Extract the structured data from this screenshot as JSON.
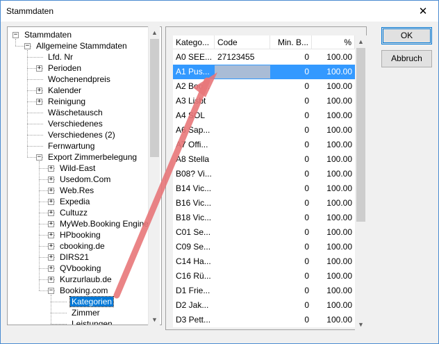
{
  "window": {
    "title": "Stammdaten"
  },
  "tree": [
    {
      "label": "Stammdaten",
      "level": 0,
      "expander": "minus"
    },
    {
      "label": "Allgemeine Stammdaten",
      "level": 1,
      "expander": "minus"
    },
    {
      "label": "Lfd. Nr",
      "level": 2,
      "expander": "none"
    },
    {
      "label": "Perioden",
      "level": 2,
      "expander": "plus"
    },
    {
      "label": "Wochenendpreis",
      "level": 2,
      "expander": "none"
    },
    {
      "label": "Kalender",
      "level": 2,
      "expander": "plus"
    },
    {
      "label": "Reinigung",
      "level": 2,
      "expander": "plus"
    },
    {
      "label": "Wäschetausch",
      "level": 2,
      "expander": "none"
    },
    {
      "label": "Verschiedenes",
      "level": 2,
      "expander": "none"
    },
    {
      "label": "Verschiedenes (2)",
      "level": 2,
      "expander": "none"
    },
    {
      "label": "Fernwartung",
      "level": 2,
      "expander": "none"
    },
    {
      "label": "Export Zimmerbelegung",
      "level": 2,
      "expander": "minus"
    },
    {
      "label": "Wild-East",
      "level": 3,
      "expander": "plus"
    },
    {
      "label": "Usedom.Com",
      "level": 3,
      "expander": "plus"
    },
    {
      "label": "Web.Res",
      "level": 3,
      "expander": "plus"
    },
    {
      "label": "Expedia",
      "level": 3,
      "expander": "plus"
    },
    {
      "label": "Cultuzz",
      "level": 3,
      "expander": "plus"
    },
    {
      "label": "MyWeb.Booking Engine",
      "level": 3,
      "expander": "plus"
    },
    {
      "label": "HPbooking",
      "level": 3,
      "expander": "plus"
    },
    {
      "label": "cbooking.de",
      "level": 3,
      "expander": "plus"
    },
    {
      "label": "DIRS21",
      "level": 3,
      "expander": "plus"
    },
    {
      "label": "QVbooking",
      "level": 3,
      "expander": "plus"
    },
    {
      "label": "Kurzurlaub.de",
      "level": 3,
      "expander": "plus"
    },
    {
      "label": "Booking.com",
      "level": 3,
      "expander": "minus"
    },
    {
      "label": "Kategorien",
      "level": 4,
      "expander": "none",
      "selected": true
    },
    {
      "label": "Zimmer",
      "level": 4,
      "expander": "none"
    },
    {
      "label": "Leistungen",
      "level": 4,
      "expander": "none"
    }
  ],
  "grid": {
    "columns": [
      "Katego...",
      "Code",
      "Min. B...",
      "%"
    ],
    "rows": [
      {
        "kat": "A0 SEE...",
        "code": "27123455",
        "min": "0",
        "pct": "100.00"
      },
      {
        "kat": "A1 Pus...",
        "code": "",
        "min": "0",
        "pct": "100.00",
        "selected": true
      },
      {
        "kat": "A2 Boo...",
        "code": "",
        "min": "0",
        "pct": "100.00"
      },
      {
        "kat": "A3 Lisbt",
        "code": "",
        "min": "0",
        "pct": "100.00"
      },
      {
        "kat": "A4 SOL",
        "code": "",
        "min": "0",
        "pct": "100.00"
      },
      {
        "kat": "A6 Sap...",
        "code": "",
        "min": "0",
        "pct": "100.00"
      },
      {
        "kat": "A7 Offi...",
        "code": "",
        "min": "0",
        "pct": "100.00"
      },
      {
        "kat": "A8 Stella",
        "code": "",
        "min": "0",
        "pct": "100.00"
      },
      {
        "kat": "B08? Vi...",
        "code": "",
        "min": "0",
        "pct": "100.00"
      },
      {
        "kat": "B14 Vic...",
        "code": "",
        "min": "0",
        "pct": "100.00"
      },
      {
        "kat": "B16 Vic...",
        "code": "",
        "min": "0",
        "pct": "100.00"
      },
      {
        "kat": "B18 Vic...",
        "code": "",
        "min": "0",
        "pct": "100.00"
      },
      {
        "kat": "C01 Se...",
        "code": "",
        "min": "0",
        "pct": "100.00"
      },
      {
        "kat": "C09 Se...",
        "code": "",
        "min": "0",
        "pct": "100.00"
      },
      {
        "kat": "C14 Ha...",
        "code": "",
        "min": "0",
        "pct": "100.00"
      },
      {
        "kat": "C16 Rü...",
        "code": "",
        "min": "0",
        "pct": "100.00"
      },
      {
        "kat": "D1 Frie...",
        "code": "",
        "min": "0",
        "pct": "100.00"
      },
      {
        "kat": "D2 Jak...",
        "code": "",
        "min": "0",
        "pct": "100.00"
      },
      {
        "kat": "D3 Pett...",
        "code": "",
        "min": "0",
        "pct": "100.00"
      }
    ]
  },
  "buttons": {
    "ok": "OK",
    "cancel": "Abbruch"
  },
  "icons": {
    "close": "close-icon",
    "scroll_up": "chevron-up-icon",
    "scroll_down": "chevron-down-icon",
    "annotation": "red-arrow-icon"
  },
  "colors": {
    "selection": "#0078d7",
    "grid_selection": "#3399ff",
    "annotation_arrow": "#e8777a",
    "window_border": "#4a8bd1"
  }
}
